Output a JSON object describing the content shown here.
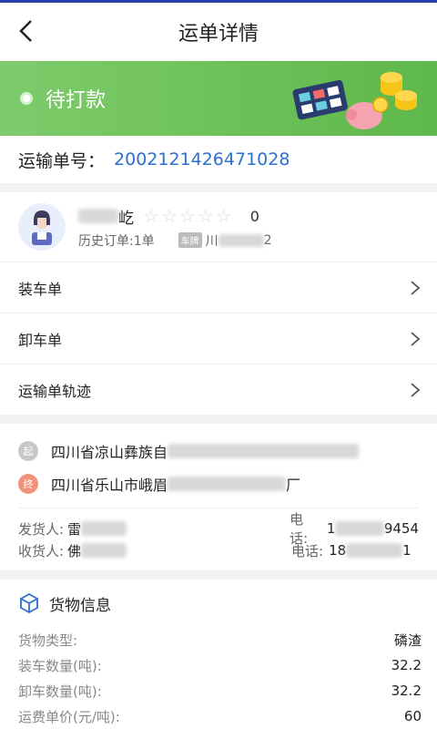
{
  "header": {
    "title": "运单详情"
  },
  "status": {
    "label": "待打款",
    "accent": "#5eb84a"
  },
  "waybill": {
    "label": "运输单号：",
    "number": "2002121426471028"
  },
  "driver": {
    "name_visible": "屹",
    "rating": 0,
    "history_orders": "历史订单:1单",
    "plate_tag": "车牌",
    "plate_visible_prefix": "川",
    "plate_visible_suffix": "2"
  },
  "links": [
    {
      "label": "装车单"
    },
    {
      "label": "卸车单"
    },
    {
      "label": "运输单轨迹"
    }
  ],
  "route": {
    "start_badge": "起",
    "start_address": "四川省凉山彝族自",
    "end_badge": "终",
    "end_address_prefix": "四川省乐山市峨眉",
    "end_address_suffix": "厂"
  },
  "contacts": {
    "shipper_label": "发货人:",
    "shipper_name": "雷",
    "shipper_phone_label": "电话:",
    "shipper_phone_prefix": "1",
    "shipper_phone_suffix": "9454",
    "receiver_label": "收货人:",
    "receiver_name": "佛",
    "receiver_phone_label": "电话:",
    "receiver_phone_prefix": "18",
    "receiver_phone_suffix": "1"
  },
  "cargo": {
    "section_title": "货物信息",
    "rows": [
      {
        "label": "货物类型:",
        "value": "磷渣"
      },
      {
        "label": "装车数量(吨):",
        "value": "32.2"
      },
      {
        "label": "卸车数量(吨):",
        "value": "32.2"
      },
      {
        "label": "运费单价(元/吨):",
        "value": "60"
      }
    ]
  },
  "icons": [
    "back-arrow-icon",
    "chevron-right-icon",
    "box-icon",
    "star-icon",
    "avatar-icon",
    "calculator-coins-illustration"
  ]
}
